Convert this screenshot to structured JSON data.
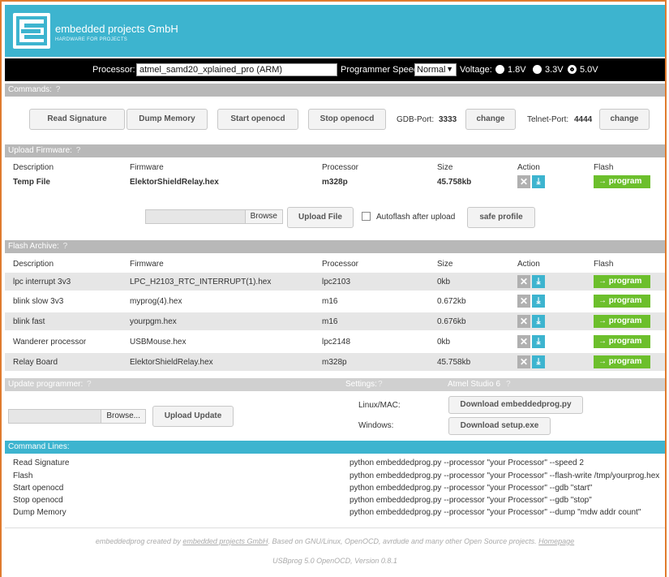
{
  "header": {
    "brand": "embedded projects GmbH",
    "tagline": "HARDWARE FOR PROJECTS"
  },
  "procbar": {
    "processor_label": "Processor:",
    "processor_value": "atmel_samd20_xplained_pro (ARM)",
    "speed_label": "Programmer Speed:",
    "speed_value": "Normal",
    "voltage_label": "Voltage:",
    "voltages": [
      "1.8V",
      "3.3V",
      "5.0V"
    ],
    "selected_voltage": "5.0V"
  },
  "commands": {
    "title": "Commands:",
    "help": "?",
    "read_signature": "Read Signature",
    "dump_memory": "Dump Memory",
    "start_openocd": "Start openocd",
    "stop_openocd": "Stop openocd",
    "gdb_port_label": "GDB-Port:",
    "gdb_port": "3333",
    "change": "change",
    "telnet_port_label": "Telnet-Port:",
    "telnet_port": "4444"
  },
  "upload": {
    "title": "Upload Firmware:",
    "help": "?",
    "headers": [
      "Description",
      "Firmware",
      "Processor",
      "Size",
      "Action",
      "Flash"
    ],
    "row": {
      "description": "Temp File",
      "firmware": "ElektorShieldRelay.hex",
      "processor": "m328p",
      "size": "45.758kb"
    },
    "browse": "Browse",
    "upload_file": "Upload File",
    "autoflash": "Autoflash after upload",
    "autoflash_checked": false,
    "safe_profile": "safe profile",
    "program": "→ program"
  },
  "archive": {
    "title": "Flash Archive:",
    "help": "?",
    "headers": [
      "Description",
      "Firmware",
      "Processor",
      "Size",
      "Action",
      "Flash"
    ],
    "rows": [
      {
        "description": "lpc interrupt 3v3",
        "firmware": "LPC_H2103_RTC_INTERRUPT(1).hex",
        "processor": "lpc2103",
        "size": "0kb"
      },
      {
        "description": "blink slow 3v3",
        "firmware": "myprog(4).hex",
        "processor": "m16",
        "size": "0.672kb"
      },
      {
        "description": "blink fast",
        "firmware": "yourpgm.hex",
        "processor": "m16",
        "size": "0.676kb"
      },
      {
        "description": "Wanderer processor",
        "firmware": "USBMouse.hex",
        "processor": "lpc2148",
        "size": "0kb"
      },
      {
        "description": "Relay Board",
        "firmware": "ElektorShieldRelay.hex",
        "processor": "m328p",
        "size": "45.758kb"
      }
    ],
    "program": "→ program"
  },
  "update": {
    "title": "Update programmer:",
    "help": "?",
    "browse": "Browse...",
    "upload_update": "Upload Update",
    "settings_title": "Settings:",
    "atmel_title": "Atmel Studio 6",
    "linux_label": "Linux/MAC:",
    "windows_label": "Windows:",
    "download_py": "Download embeddedprog.py",
    "download_exe": "Download setup.exe"
  },
  "cmdlines": {
    "title": "Command Lines:",
    "items": [
      {
        "name": "Read Signature",
        "cmd": "python embeddedprog.py --processor \"your Processor\" --speed 2"
      },
      {
        "name": "Flash",
        "cmd": "python embeddedprog.py --processor \"your Processor\" --flash-write /tmp/yourprog.hex"
      },
      {
        "name": "Start openocd",
        "cmd": "python embeddedprog.py --processor \"your Processor\" --gdb \"start\""
      },
      {
        "name": "Stop openocd",
        "cmd": "python embeddedprog.py --processor \"your Processor\" --gdb \"stop\""
      },
      {
        "name": "Dump Memory",
        "cmd": "python embeddedprog.py --processor \"your Processor\" --dump \"mdw addr count\""
      }
    ]
  },
  "footer": {
    "pre": "embeddedprog created by ",
    "link": "embedded projects GmbH",
    "mid": ". Based on GNU/Linux, OpenOCD, avrdude and many other Open Source projects. ",
    "home": "Homepage",
    "version": "USBprog 5.0 OpenOCD, Version 0.8.1"
  },
  "colors": {
    "accent": "#3db4cf",
    "program_green": "#6cbf2c",
    "frame_orange": "#e07b2e"
  }
}
